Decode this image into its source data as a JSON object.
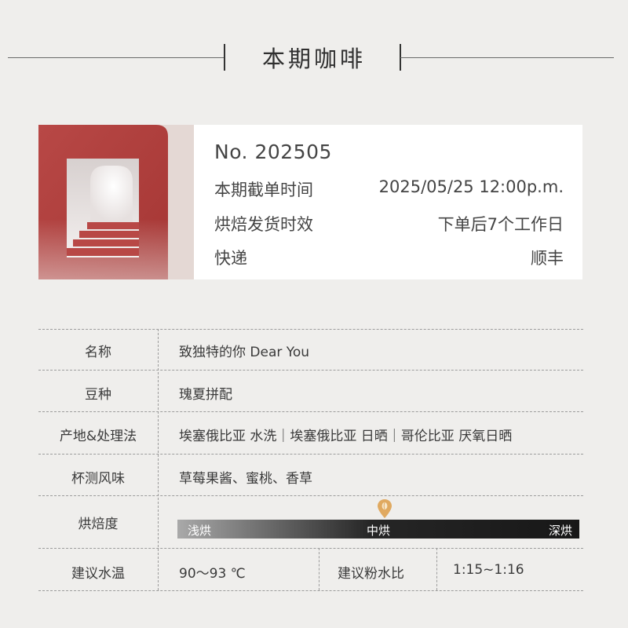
{
  "header": {
    "title": "本期咖啡"
  },
  "info": {
    "issue_no": "No. 202505",
    "rows": [
      {
        "label": "本期截单时间",
        "value": "2025/05/25 12:00p.m."
      },
      {
        "label": "烘焙发货时效",
        "value": "下单后7个工作日"
      },
      {
        "label": "快递",
        "value": "顺丰"
      }
    ]
  },
  "details": {
    "name": {
      "label": "名称",
      "value": "致独特的你 Dear You"
    },
    "bean": {
      "label": "豆种",
      "value": "瑰夏拼配"
    },
    "origin": {
      "label": "产地&处理法",
      "value": "埃塞俄比亚 水洗｜埃塞俄比亚 日晒｜哥伦比亚 厌氧日晒"
    },
    "flavor": {
      "label": "杯测风味",
      "value": "草莓果酱、蜜桃、香草"
    },
    "roast": {
      "label": "烘焙度",
      "scale": [
        "浅烘",
        "中烘",
        "深烘"
      ],
      "selected": "中烘",
      "level": 0.5
    },
    "water": {
      "label": "建议水温",
      "value": "90～93 ℃"
    },
    "ratio": {
      "label": "建议粉水比",
      "value": "1:15~1:16"
    }
  },
  "colors": {
    "background": "#efeeec",
    "card_red": "#a83a38",
    "pin": "#e0a960"
  }
}
